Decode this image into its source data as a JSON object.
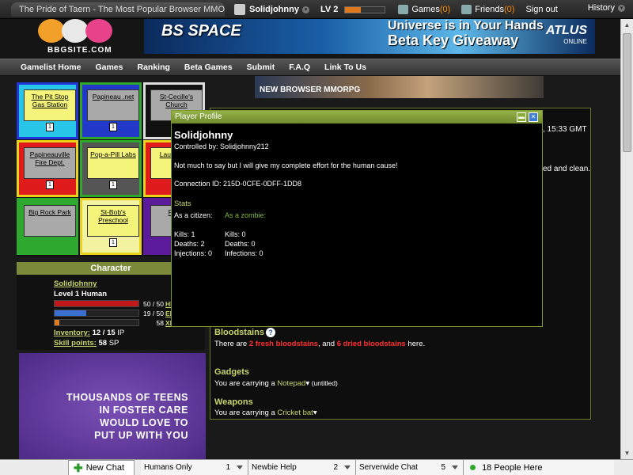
{
  "window": {
    "tab_title": "The Pride of Taern - The Most Popular Browser MMORPG"
  },
  "topbar": {
    "username": "Solidjohnny",
    "level": "LV 2",
    "xp_fraction": 0.4,
    "games_label": "Games",
    "games_count": "(0)",
    "friends_label": "Friends",
    "friends_count": "(0)",
    "signout": "Sign out",
    "history": "History"
  },
  "header": {
    "logo_text": "BBGSITE.COM",
    "banner_game": "BS SPACE",
    "banner_line1": "Universe is in Your Hands",
    "banner_line2": "Beta Key Giveaway",
    "banner_brand": "ATLUS",
    "banner_brand_sub": "ONLINE"
  },
  "nav": [
    "Gamelist Home",
    "Games",
    "Ranking",
    "Beta Games",
    "Submit",
    "F.A.Q",
    "Link To Us"
  ],
  "top_image_text": "NEW BROWSER MMORPG",
  "map": {
    "cells": [
      {
        "label": "The Pit Stop Gas Station",
        "count": "1",
        "bg": "#29c5e8",
        "border": "#2238d6",
        "fill": "#f4f47a"
      },
      {
        "label": "Papineau .net",
        "count": "1",
        "bg": "#2238c8",
        "border": "#2da82d",
        "fill": "#a9a9a9"
      },
      {
        "label": "St-Cecille's Church",
        "count": "",
        "bg": "#111111",
        "border": "#dddddd",
        "fill": "#a9a9a9"
      },
      {
        "label": "Papineauville Fire Dept.",
        "count": "1",
        "bg": "#e01b1b",
        "border": "#e8d21a",
        "fill": "#a9a9a9"
      },
      {
        "label": "Pop-a-Pill Labs",
        "count": "1",
        "bg": "#555555",
        "border": "#2da82d",
        "fill": "#f4f47a"
      },
      {
        "label": "Laur Police",
        "count": "1",
        "bg": "#e01b1b",
        "border": "#e8d21a",
        "fill": "#f4f47a"
      },
      {
        "label": "Big Rock Park",
        "count": "",
        "bg": "#2fa82f",
        "border": "#2fa82f",
        "fill": "#a9a9a9"
      },
      {
        "label": "St-Bob's Preschool",
        "count": "1",
        "bg": "#f2f2a0",
        "border": "#e8d21a",
        "fill": "#f4f47a"
      },
      {
        "label": "Fishe",
        "count": "",
        "bg": "#5b1b9b",
        "border": "#5b1b9b",
        "fill": "#a9a9a9"
      }
    ]
  },
  "character": {
    "header": "Character",
    "name": "Solidjohnny",
    "level": "Level 1 Human",
    "hp": {
      "value": "50 / 50",
      "label": "HP",
      "fraction": 1.0,
      "color": "#c01818"
    },
    "ep": {
      "value": "19 / 50",
      "label": "EP",
      "fraction": 0.38,
      "color": "#3a6fd0"
    },
    "xp": {
      "value": "58",
      "label": "XP",
      "fraction": 0.06,
      "color": "#e07a1f"
    },
    "inventory_label": "Inventory:",
    "inventory_value": "12 / 15",
    "inventory_unit": "IP",
    "skill_label": "Skill points:",
    "skill_value": "58",
    "skill_unit": "SP"
  },
  "ad": {
    "lines": [
      "THOUSANDS OF TEENS",
      "IN FOSTER CARE",
      "WOULD LOVE TO",
      "PUT UP WITH YOU"
    ]
  },
  "content": {
    "date_fragment": ", 15:33 GMT",
    "clean_fragment": "ed and clean.",
    "bloodstains": {
      "title": "Bloodstains",
      "prefix": "There are",
      "fresh": "2 fresh bloodstains",
      "middle": ", and",
      "dried": "6 dried bloodstains",
      "suffix": "here."
    },
    "gadgets": {
      "title": "Gadgets",
      "prefix": "You are carrying a",
      "item": "Notepad",
      "suffix": "(untitled)"
    },
    "weapons": {
      "title": "Weapons",
      "prefix": "You are carrying a",
      "item": "Cricket bat"
    }
  },
  "popup": {
    "title": "Player Profile",
    "name": "Solidjohnny",
    "controlled": "Controlled by: Solidjohnny212",
    "bio": "Not much to say but I will give my complete effort for the human cause!",
    "connection": "Connection ID: 215D-0CFE-0DFF-1DD8",
    "stats_title": "Stats",
    "citizen_label": "As a citizen:",
    "zombie_label": "As a zombie:",
    "citizen": {
      "kills": "Kills: 1",
      "deaths": "Deaths: 2",
      "injections": "Injections: 0"
    },
    "zombie": {
      "kills": "Kills: 0",
      "deaths": "Deaths: 0",
      "infections": "Infections: 0"
    }
  },
  "chatbar": {
    "new_chat": "New Chat",
    "tabs": [
      {
        "name": "Humans Only",
        "count": "1"
      },
      {
        "name": "Newbie Help",
        "count": "2"
      },
      {
        "name": "Serverwide Chat",
        "count": "5"
      }
    ],
    "people": "18 People Here"
  }
}
